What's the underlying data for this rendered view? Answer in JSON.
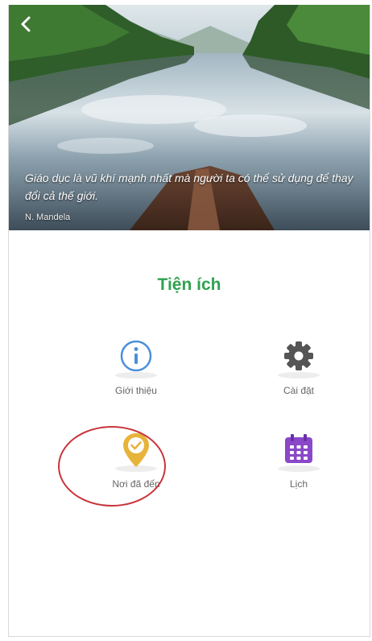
{
  "header": {
    "back_icon": "chevron-left-icon",
    "quote": "Giáo dục là vũ khí mạnh nhất mà người ta có thể sử dụng để thay đổi cả thế giới.",
    "author": "N. Mandela"
  },
  "section": {
    "title": "Tiện ích"
  },
  "utilities": [
    {
      "label": "Giới thiệu",
      "icon": "info-icon",
      "color": "#4a8fd8"
    },
    {
      "label": "Cài đặt",
      "icon": "gear-icon",
      "color": "#555555"
    },
    {
      "label": "Nơi đã đến",
      "icon": "location-check-icon",
      "color": "#e6b43a"
    },
    {
      "label": "Lịch",
      "icon": "calendar-icon",
      "color": "#8a48c9"
    }
  ],
  "colors": {
    "title_green": "#2fa24f",
    "highlight_red": "#c8343a"
  }
}
